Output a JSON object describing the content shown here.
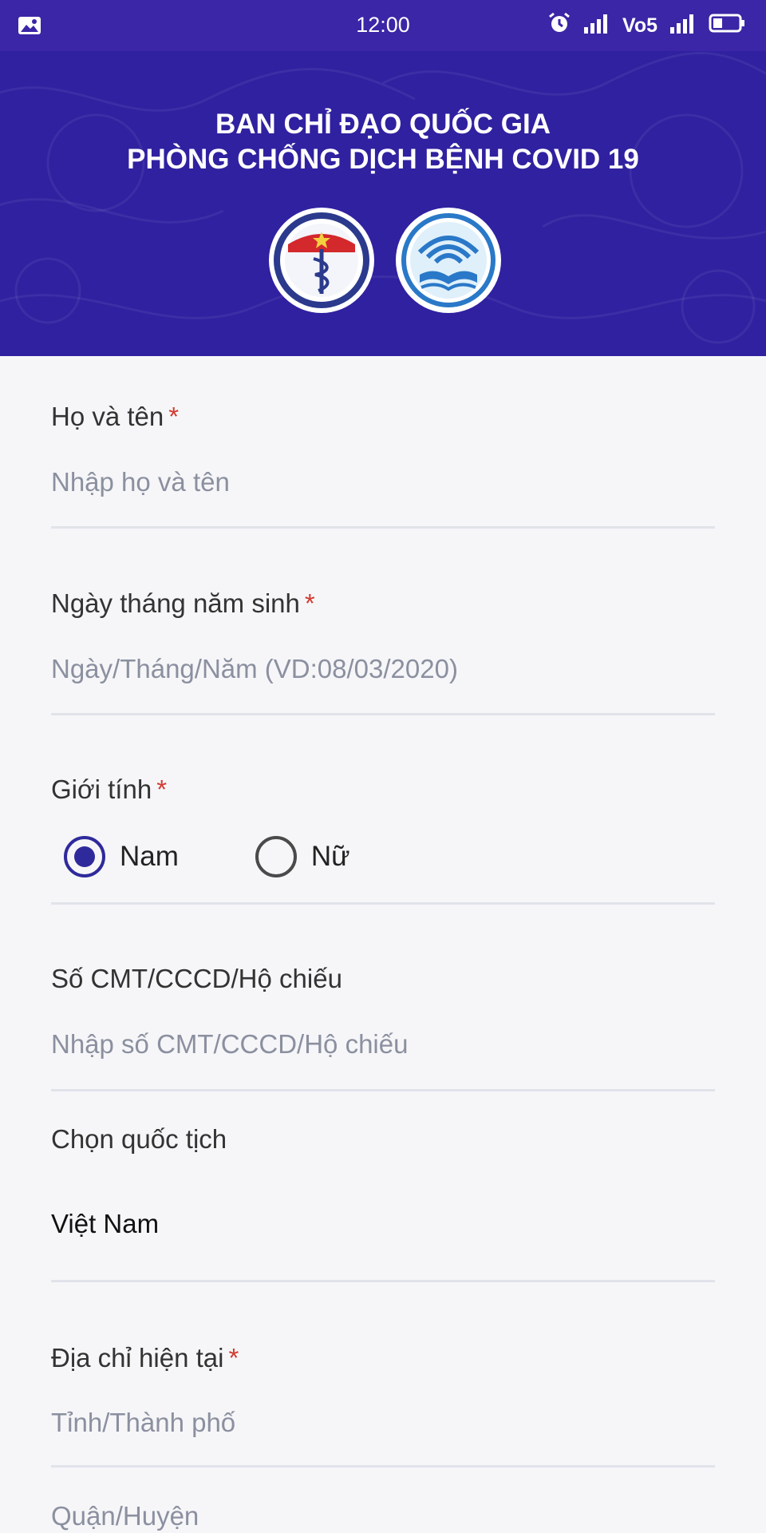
{
  "status_bar": {
    "time": "12:00",
    "network_label": "Vo5",
    "icons": [
      "gallery-icon",
      "alarm-icon",
      "wifi-signal-icon",
      "cellular-signal-icon",
      "battery-icon"
    ]
  },
  "header": {
    "title_line1": "BAN CHỈ ĐẠO QUỐC GIA",
    "title_line2": "PHÒNG CHỐNG DỊCH BỆNH COVID 19",
    "logos": [
      "ministry-of-health-logo",
      "ministry-of-information-logo"
    ],
    "colors": {
      "background": "#3021a0",
      "status_bar": "#3a26a6"
    }
  },
  "form": {
    "full_name": {
      "label": "Họ và tên",
      "required_mark": "*",
      "placeholder": "Nhập họ và tên"
    },
    "birth_date": {
      "label": "Ngày tháng năm sinh",
      "required_mark": "*",
      "placeholder": "Ngày/Tháng/Năm (VD:08/03/2020)"
    },
    "gender": {
      "label": "Giới tính",
      "required_mark": "*",
      "options": [
        {
          "label": "Nam",
          "selected": true
        },
        {
          "label": "Nữ",
          "selected": false
        }
      ]
    },
    "id_number": {
      "label": "Số CMT/CCCD/Hộ chiếu",
      "placeholder": "Nhập số CMT/CCCD/Hộ chiếu"
    },
    "nationality": {
      "label": "Chọn quốc tịch",
      "value": "Việt Nam"
    },
    "address": {
      "label": "Địa chỉ hiện tại",
      "required_mark": "*",
      "province_placeholder": "Tỉnh/Thành phố",
      "district_placeholder": "Quận/Huyện"
    },
    "colors": {
      "accent": "#2f2a9b",
      "required": "#d33a2f",
      "divider": "#e1e3ea"
    }
  }
}
